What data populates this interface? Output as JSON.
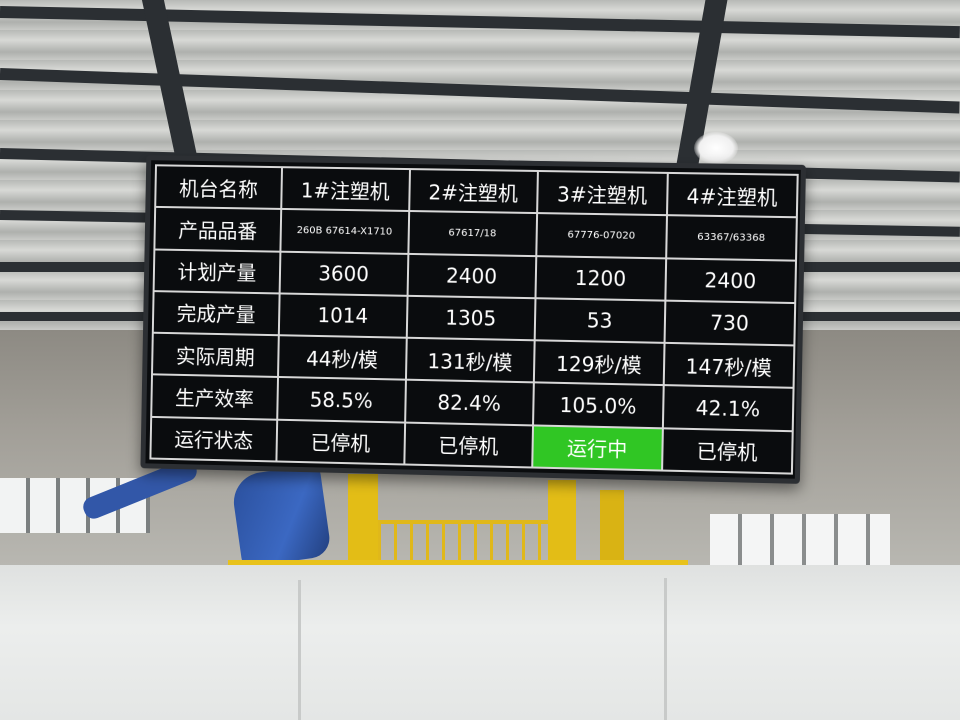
{
  "board": {
    "columns": [
      "机台名称",
      "1#注塑机",
      "2#注塑机",
      "3#注塑机",
      "4#注塑机"
    ],
    "rows": [
      {
        "label": "产品品番",
        "values": [
          "260B 67614-X1710",
          "67617/18",
          "67776-07020",
          "63367/63368"
        ]
      },
      {
        "label": "计划产量",
        "values": [
          "3600",
          "2400",
          "1200",
          "2400"
        ]
      },
      {
        "label": "完成产量",
        "values": [
          "1014",
          "1305",
          "53",
          "730"
        ]
      },
      {
        "label": "实际周期",
        "values": [
          "44秒/模",
          "131秒/模",
          "129秒/模",
          "147秒/模"
        ]
      },
      {
        "label": "生产效率",
        "values": [
          "58.5%",
          "82.4%",
          "105.0%",
          "42.1%"
        ]
      },
      {
        "label": "运行状态",
        "values": [
          "已停机",
          "已停机",
          "运行中",
          "已停机"
        ]
      }
    ],
    "colors": {
      "background": "#0a0c0e",
      "text": "#ffffff",
      "running": "#30c624",
      "grid": "#d8d8d8"
    }
  }
}
